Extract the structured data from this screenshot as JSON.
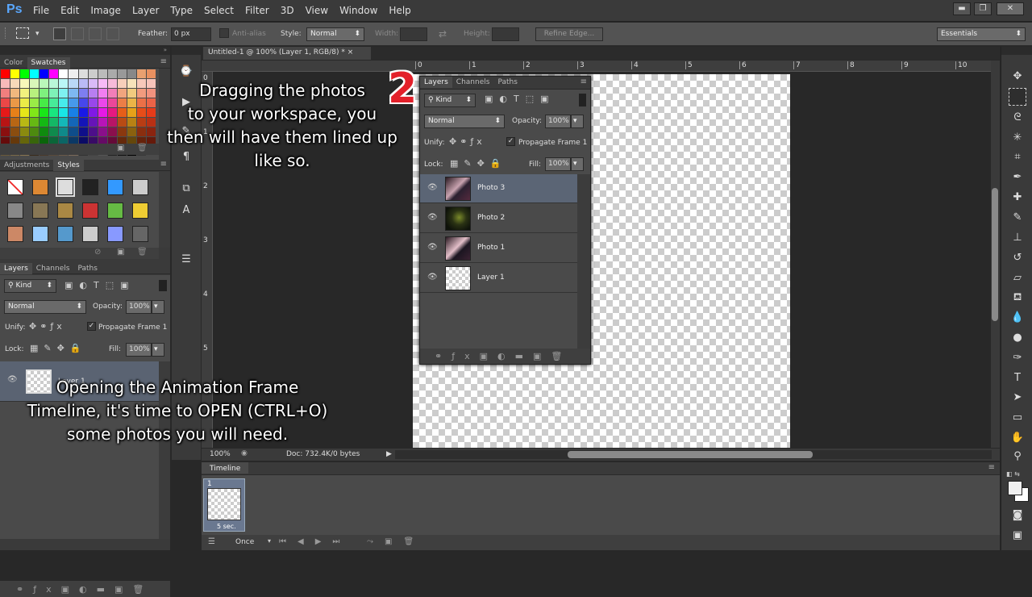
{
  "app": {
    "logo": "Ps"
  },
  "menu": [
    "File",
    "Edit",
    "Image",
    "Layer",
    "Type",
    "Select",
    "Filter",
    "3D",
    "View",
    "Window",
    "Help"
  ],
  "options": {
    "feather_label": "Feather:",
    "feather_value": "0 px",
    "antialias_label": "Anti-alias",
    "style_label": "Style:",
    "style_value": "Normal",
    "width_label": "Width:",
    "height_label": "Height:",
    "refine_edge": "Refine Edge...",
    "workspace": "Essentials"
  },
  "left_panels": {
    "swatch_tabs": [
      "Color",
      "Swatches"
    ],
    "style_tabs": [
      "Adjustments",
      "Styles"
    ],
    "layer_tabs": [
      "Layers",
      "Channels",
      "Paths"
    ],
    "kind": "Kind",
    "blend": "Normal",
    "opacity_label": "Opacity:",
    "opacity": "100%",
    "unify_label": "Unify:",
    "propagate": "Propagate Frame 1",
    "lock_label": "Lock:",
    "fill_label": "Fill:",
    "fill": "100%",
    "layers": [
      {
        "name": "Layer 1"
      }
    ]
  },
  "document": {
    "tab_title": "Untitled-1 @ 100% (Layer 1, RGB/8) *",
    "close": "×",
    "zoom": "100%",
    "doc_info": "Doc: 732.4K/0 bytes"
  },
  "ruler": {
    "h": [
      "0",
      "1",
      "2",
      "3",
      "4",
      "5",
      "6",
      "7",
      "8",
      "9",
      "10"
    ],
    "v": [
      "0",
      "1",
      "2",
      "3",
      "4",
      "5"
    ]
  },
  "float_layers": {
    "tabs": [
      "Layers",
      "Channels",
      "Paths"
    ],
    "kind": "Kind",
    "blend": "Normal",
    "opacity_label": "Opacity:",
    "opacity": "100%",
    "unify_label": "Unify:",
    "propagate": "Propagate Frame 1",
    "lock_label": "Lock:",
    "fill_label": "Fill:",
    "fill": "100%",
    "layers": [
      {
        "name": "Photo 3"
      },
      {
        "name": "Photo 2"
      },
      {
        "name": "Photo 1"
      },
      {
        "name": "Layer 1"
      }
    ]
  },
  "timeline": {
    "title": "Timeline",
    "frame_number": "1",
    "frame_delay": "5 sec.",
    "loop": "Once"
  },
  "overlay": {
    "step": "2",
    "text_top": [
      "Dragging the photos",
      "to your workspace, you",
      "then will have them lined up",
      "like so."
    ],
    "text_bottom": [
      "Opening the Animation Frame",
      "Timeline, it's time to OPEN (CTRL+O)",
      "some photos you will need."
    ]
  },
  "colors": {
    "accent": "#5aa8ff",
    "step_red": "#e3202a",
    "selected_row": "#5b6575"
  }
}
